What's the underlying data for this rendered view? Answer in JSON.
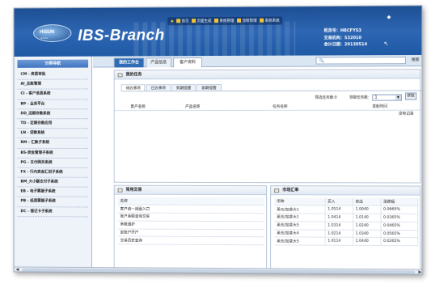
{
  "header": {
    "logo_text": "HISUN",
    "logo_sub": "HISUN",
    "brand": "IBS-Branch",
    "nav": [
      "首页",
      "页面生成",
      "系统管理",
      "流程管理",
      "系统系统"
    ],
    "user": {
      "teller_line": "柜员号：HBCFYS3",
      "org_line": "交易机构：532010",
      "date_line": "会计日期：20130514"
    }
  },
  "sidebar": {
    "title": "分类导航",
    "items": [
      "CM - 资质审批",
      "AI_总账管理",
      "CI - 客户信息系统",
      "BP - 业务平台",
      "DD_活期存款系统",
      "TD - 定期存款应用",
      "LN - 贷款系统",
      "RM - 汇款子系统",
      "BS-资金管理子系统",
      "PG - 支付网关系统",
      "FX - 行内资金汇划子系统",
      "BM_大小额支付子系统",
      "EB - 电子票据子系统",
      "PB - 纸质票据子系统",
      "DC - 借记卡子系统"
    ]
  },
  "tabs": [
    "我的工作台",
    "产品信息",
    "客户资料"
  ],
  "search": {
    "placeholder": "",
    "button": "搜索"
  },
  "tasks": {
    "title": "我的任务",
    "subtabs": [
      "待办事项",
      "已办事项",
      "到期提醒",
      "逾期提醒"
    ],
    "filter_label": "筛选任务数:0",
    "fetch_label": "领取任务数:",
    "select_value": "1",
    "fetch_button": "获取",
    "columns": [
      "客户名称",
      "产品名称",
      "任务名称",
      "发起时间"
    ],
    "empty_text": "没有记录"
  },
  "common": {
    "title": "常用交易",
    "header": "名称",
    "rows": [
      "客户统一视图入口",
      "账户余额查询交易",
      "参数维护",
      "定账户开户",
      "交易历史查询"
    ]
  },
  "rates": {
    "title": "市场汇率",
    "columns": [
      "币种",
      "买入",
      "卖出",
      "涨跌幅"
    ],
    "rows": [
      [
        "美元/加拿大1",
        "1.0514",
        "1.0040",
        "0.0665%"
      ],
      [
        "美元/加拿大1",
        "1.0414",
        "1.0140",
        "0.0365%"
      ],
      [
        "美元/加拿大5",
        "1.0314",
        "1.0240",
        "0.0465%"
      ],
      [
        "美元/加拿大4",
        "1.0214",
        "1.0340",
        "0.0565%"
      ],
      [
        "美元/加拿大5",
        "1.0114",
        "1.0440",
        "0.0265%"
      ]
    ]
  },
  "colors": {
    "header_blue": "#1f5aa5",
    "tab_active": "#2f6cb5"
  }
}
